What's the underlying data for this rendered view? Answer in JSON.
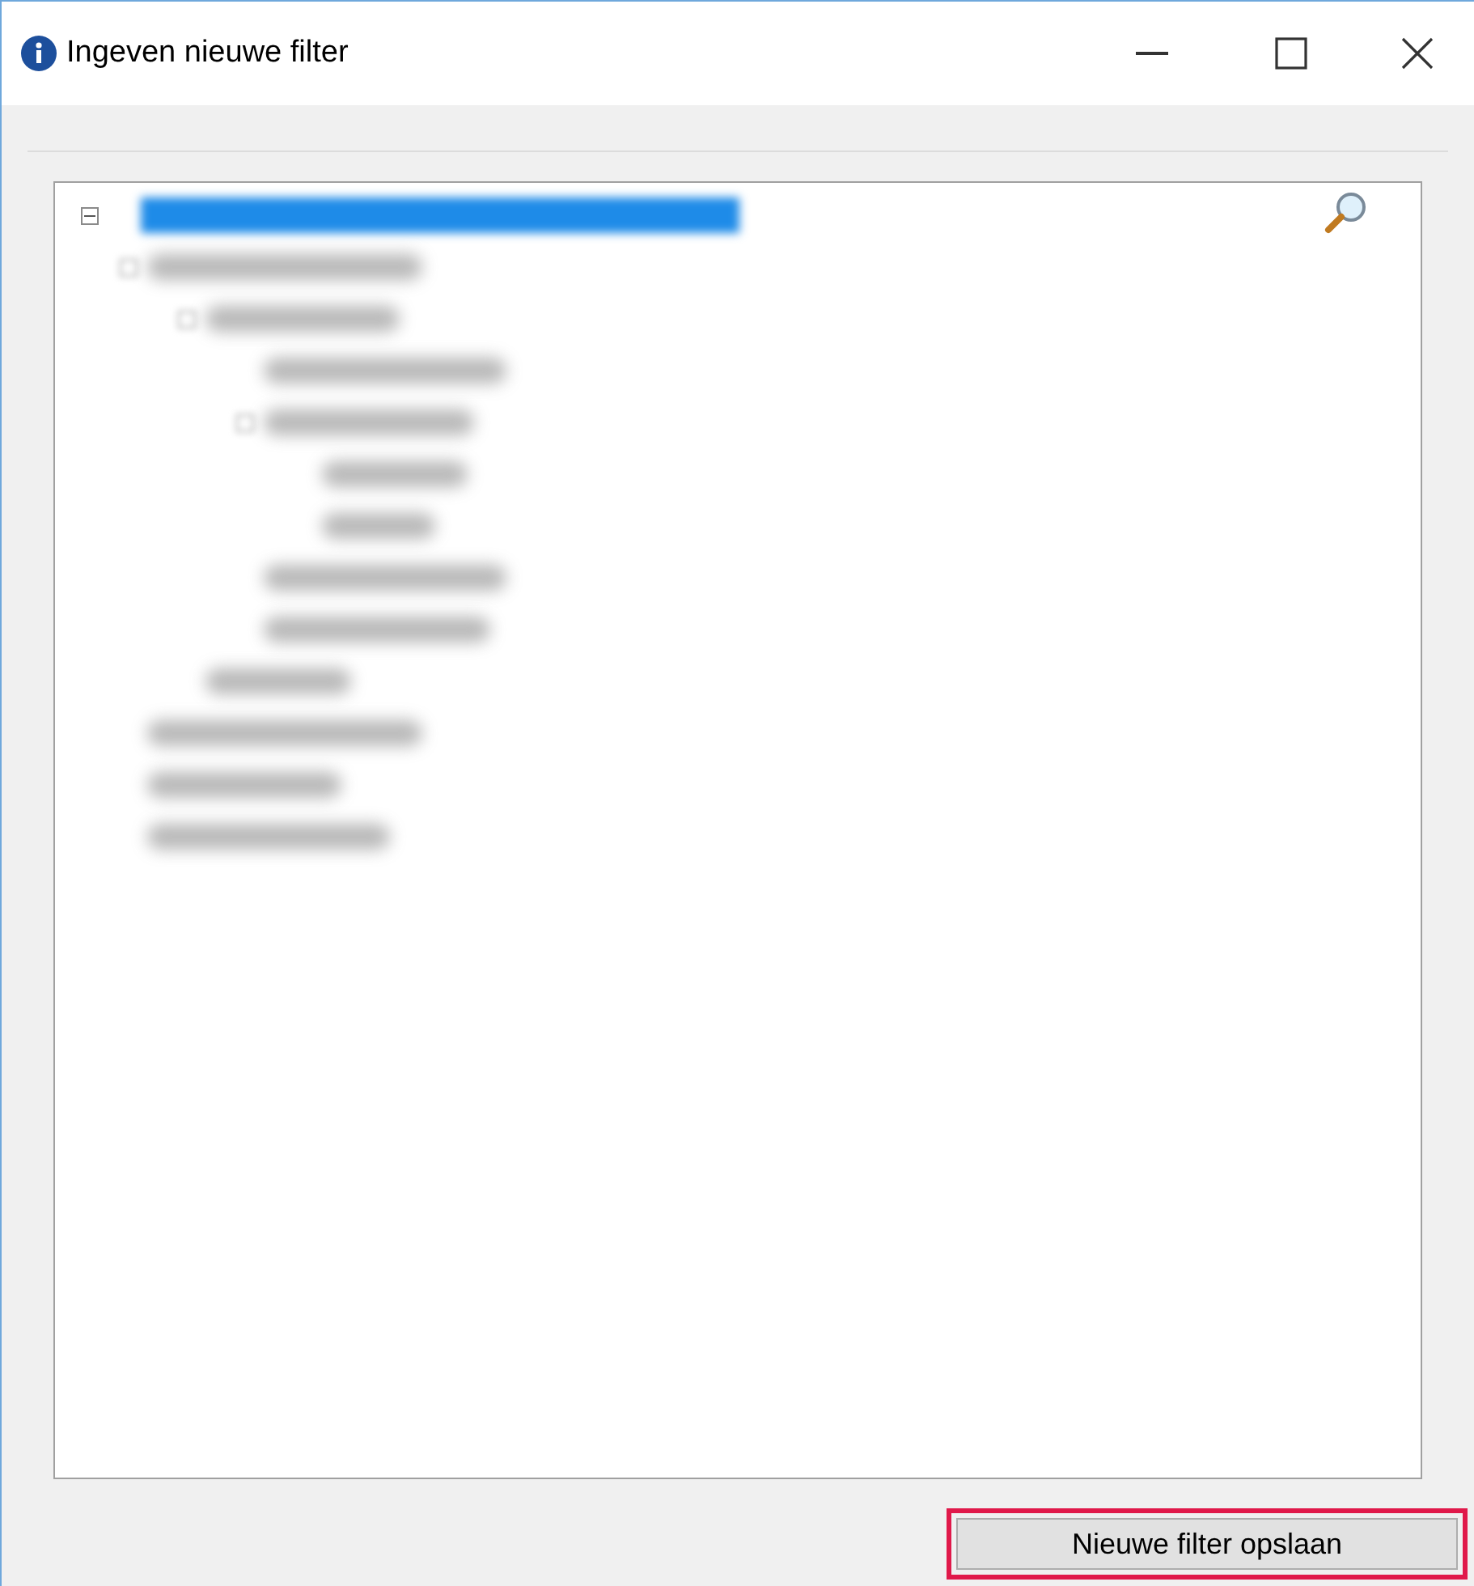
{
  "window": {
    "title": "Ingeven nieuwe filter"
  },
  "tree": {
    "expanded": true,
    "selected": true,
    "children": [
      {
        "kind": "branch",
        "expanded": true,
        "children": [
          {
            "kind": "branch",
            "expanded": true,
            "children": [
              {
                "kind": "leaf"
              },
              {
                "kind": "branch",
                "expanded": true,
                "children": [
                  {
                    "kind": "leaf"
                  },
                  {
                    "kind": "leaf"
                  }
                ]
              },
              {
                "kind": "leaf"
              },
              {
                "kind": "leaf"
              }
            ]
          },
          {
            "kind": "leaf"
          }
        ]
      },
      {
        "kind": "leaf"
      },
      {
        "kind": "leaf"
      },
      {
        "kind": "leaf"
      }
    ]
  },
  "save_button": {
    "label": "Nieuwe filter opslaan",
    "highlighted": true
  }
}
